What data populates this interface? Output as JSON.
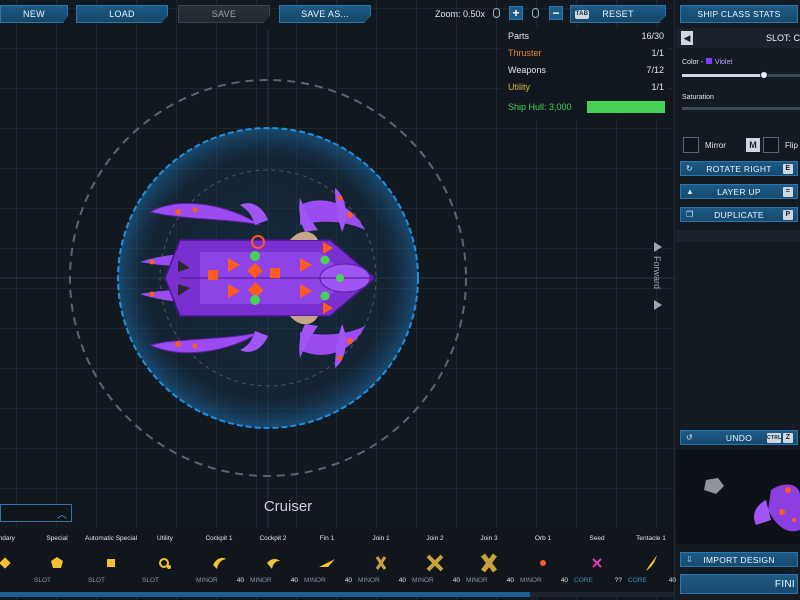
{
  "toolbar": {
    "new_label": "NEW",
    "load_label": "LOAD",
    "save_label": "SAVE",
    "save_as_label": "SAVE AS...",
    "zoom_label": "Zoom: 0.50x",
    "zoom_in": "+",
    "zoom_out": "−",
    "reset_key": "TAB",
    "reset_label": "RESET"
  },
  "stats": {
    "parts_label": "Parts",
    "parts_value": "16/30",
    "thruster_label": "Thruster",
    "thruster_value": "1/1",
    "weapons_label": "Weapons",
    "weapons_value": "7/12",
    "utility_label": "Utility",
    "utility_value": "1/1",
    "hull_label": "Ship Hull: 3,000",
    "hull_fill": 1.0
  },
  "right_panel": {
    "class_stats_label": "SHIP CLASS STATS",
    "slot_label": "SLOT: C",
    "color_label": "Color -",
    "color_value": "Violet",
    "color_swatch": "#7b3cff",
    "saturation_label": "Saturation",
    "mirror_label": "Mirror",
    "mirror_key": "M",
    "flip_label": "Flip",
    "rotate_label": "ROTATE RIGHT",
    "rotate_key": "E",
    "layer_label": "LAYER UP",
    "layer_key": "=",
    "duplicate_label": "DUPLICATE",
    "duplicate_key": "P",
    "undo_label": "UNDO",
    "undo_key_1": "CTRL",
    "undo_key_2": "Z",
    "import_label": "IMPORT DESIGN",
    "finish_label": "FINI"
  },
  "canvas": {
    "ship_name": "Cruiser",
    "forward_label": "Forward"
  },
  "parts": [
    {
      "name": "ondary",
      "type": "SLOT",
      "cost": "",
      "icon": "secondary-icon",
      "core": false
    },
    {
      "name": "Special",
      "type": "SLOT",
      "cost": "",
      "icon": "special-icon",
      "core": false
    },
    {
      "name": "Automatic Special",
      "type": "SLOT",
      "cost": "",
      "icon": "automatic-special-icon",
      "core": false
    },
    {
      "name": "Utility",
      "type": "SLOT",
      "cost": "",
      "icon": "utility-icon",
      "core": false
    },
    {
      "name": "Cockpit 1",
      "type": "MINOR",
      "cost": "40",
      "icon": "cockpit1-icon",
      "core": false
    },
    {
      "name": "Cockpit 2",
      "type": "MINOR",
      "cost": "40",
      "icon": "cockpit2-icon",
      "core": false
    },
    {
      "name": "Fin 1",
      "type": "MINOR",
      "cost": "40",
      "icon": "fin1-icon",
      "core": false
    },
    {
      "name": "Join 1",
      "type": "MINOR",
      "cost": "40",
      "icon": "join1-icon",
      "core": false
    },
    {
      "name": "Join 2",
      "type": "MINOR",
      "cost": "40",
      "icon": "join2-icon",
      "core": false
    },
    {
      "name": "Join 3",
      "type": "MINOR",
      "cost": "40",
      "icon": "join3-icon",
      "core": false
    },
    {
      "name": "Orb 1",
      "type": "MINOR",
      "cost": "40",
      "icon": "orb1-icon",
      "core": false
    },
    {
      "name": "Seed",
      "type": "CORE",
      "cost": "??",
      "icon": "seed-icon",
      "core": true
    },
    {
      "name": "Tentacle 1",
      "type": "CORE",
      "cost": "40",
      "icon": "tentacle1-icon",
      "core": true
    }
  ],
  "colors": {
    "accent": "#1d5a86",
    "thruster": "#e0892f",
    "utility": "#d6b33a",
    "hull": "#45d257",
    "ship_body": "#8b3fe0",
    "ship_accent": "#ff5a1f"
  }
}
